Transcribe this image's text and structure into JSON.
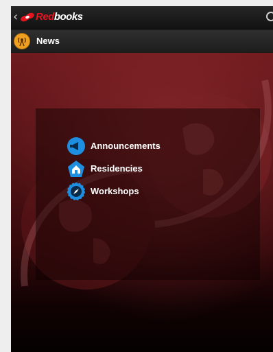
{
  "app": {
    "brand_prefix": "Red",
    "brand_suffix": "books",
    "accent": "#e4151f"
  },
  "subbar": {
    "title": "News",
    "icon": "broadcast-icon",
    "icon_color": "#f0a020"
  },
  "menu": {
    "icon_color": "#1e8fe0",
    "items": [
      {
        "label": "Announcements",
        "icon": "megaphone-icon"
      },
      {
        "label": "Residencies",
        "icon": "home-icon"
      },
      {
        "label": "Workshops",
        "icon": "compass-icon"
      }
    ]
  }
}
